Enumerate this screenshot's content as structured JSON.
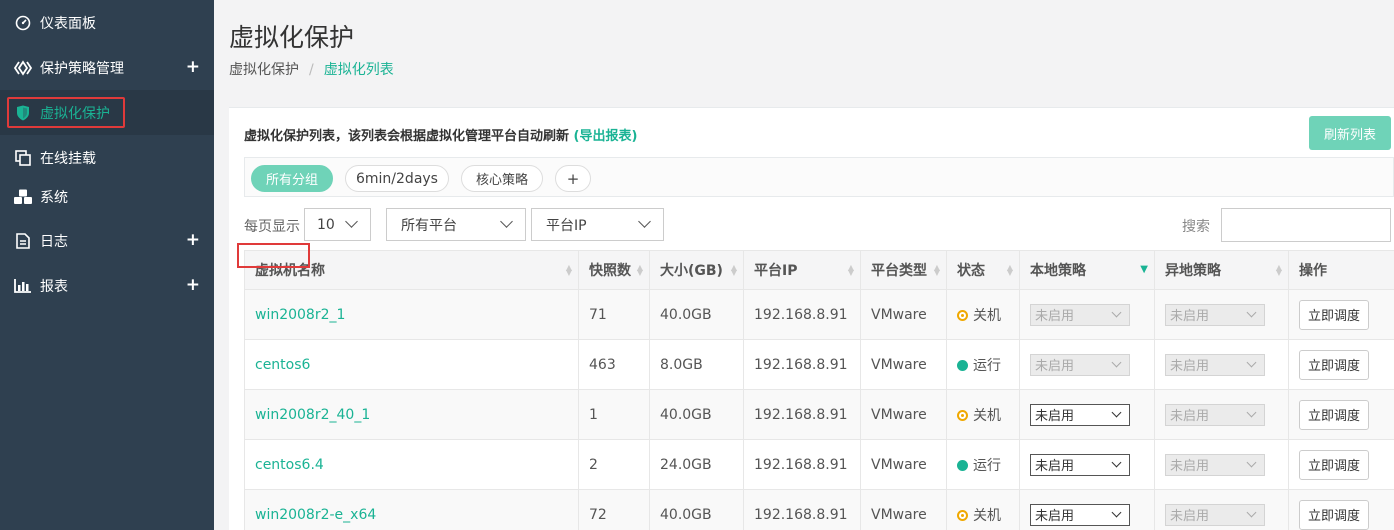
{
  "sidebar": {
    "items": [
      {
        "label": "仪表面板",
        "icon": "dashboard-icon",
        "plus": ""
      },
      {
        "label": "保护策略管理",
        "icon": "policy-diamond-icon",
        "plus": "+"
      },
      {
        "label": "虚拟化保护",
        "icon": "shield-icon",
        "plus": ""
      },
      {
        "label": "在线挂载",
        "icon": "copy-icon",
        "plus": ""
      },
      {
        "label": "系统",
        "icon": "cubes-icon",
        "plus": ""
      },
      {
        "label": "日志",
        "icon": "file-icon",
        "plus": "+"
      },
      {
        "label": "报表",
        "icon": "bar-chart-icon",
        "plus": "+"
      }
    ]
  },
  "page": {
    "title": "虚拟化保护",
    "breadcrumb": [
      "虚拟化保护",
      "虚拟化列表"
    ],
    "breadcrumb_sep": "/"
  },
  "panel": {
    "heading": "虚拟化保护列表，该列表会根据虚拟化管理平台自动刷新",
    "export_link": "(导出报表)",
    "refresh_button": "刷新列表"
  },
  "tags": [
    {
      "label": "所有分组",
      "active": true
    },
    {
      "label": "6min/2days",
      "active": false
    },
    {
      "label": "核心策略",
      "active": false
    },
    {
      "label": "+",
      "active": false
    }
  ],
  "filters": {
    "per_page_label": "每页显示",
    "per_page_value": "10",
    "platform_value": "所有平台",
    "platform_ip_value": "平台IP",
    "search_label": "搜索",
    "search_value": ""
  },
  "table": {
    "columns": [
      "虚拟机名称",
      "快照数",
      "大小(GB)",
      "平台IP",
      "平台类型",
      "状态",
      "本地策略",
      "异地策略",
      "操作"
    ],
    "rows": [
      {
        "name": "win2008r2_1",
        "snapshots": "71",
        "size": "40.0GB",
        "ip": "192.168.8.91",
        "type": "VMware",
        "status": "关机",
        "status_kind": "off",
        "local_policy": "未启用",
        "local_enabled": false,
        "remote_policy": "未启用",
        "action": "立即调度"
      },
      {
        "name": "centos6",
        "snapshots": "463",
        "size": "8.0GB",
        "ip": "192.168.8.91",
        "type": "VMware",
        "status": "运行",
        "status_kind": "on",
        "local_policy": "未启用",
        "local_enabled": false,
        "remote_policy": "未启用",
        "action": "立即调度"
      },
      {
        "name": "win2008r2_40_1",
        "snapshots": "1",
        "size": "40.0GB",
        "ip": "192.168.8.91",
        "type": "VMware",
        "status": "关机",
        "status_kind": "off",
        "local_policy": "未启用",
        "local_enabled": true,
        "remote_policy": "未启用",
        "action": "立即调度"
      },
      {
        "name": "centos6.4",
        "snapshots": "2",
        "size": "24.0GB",
        "ip": "192.168.8.91",
        "type": "VMware",
        "status": "运行",
        "status_kind": "on",
        "local_policy": "未启用",
        "local_enabled": true,
        "remote_policy": "未启用",
        "action": "立即调度"
      },
      {
        "name": "win2008r2-e_x64",
        "snapshots": "72",
        "size": "40.0GB",
        "ip": "192.168.8.91",
        "type": "VMware",
        "status": "关机",
        "status_kind": "off",
        "local_policy": "未启用",
        "local_enabled": true,
        "remote_policy": "未启用",
        "action": "立即调度"
      }
    ]
  },
  "colors": {
    "sidebar_bg": "#2f4050",
    "accent": "#1ab394",
    "highlight": "#e03a3a",
    "status_off": "#f0a800"
  }
}
